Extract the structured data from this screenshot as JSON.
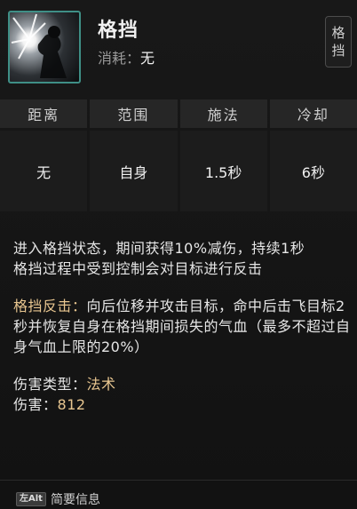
{
  "skill": {
    "name": "格挡",
    "cost_label": "消耗：",
    "cost_value": "无",
    "side_button": [
      "格",
      "挡"
    ]
  },
  "stats": {
    "headers": [
      "距离",
      "范围",
      "施法",
      "冷却"
    ],
    "values": [
      "无",
      "自身",
      "1.5秒",
      "6秒"
    ]
  },
  "description": {
    "line1": "进入格挡状态，期间获得10%减伤，持续1秒",
    "line2": "格挡过程中受到控制会对目标进行反击",
    "counter_label": "格挡反击：",
    "counter_text": "向后位移并攻击目标，命中后击飞目标2秒并恢复自身在格挡期间损失的气血（最多不超过自身气血上限的20%）",
    "damage_type_label": "伤害类型：",
    "damage_type_value": "法术",
    "damage_label": "伤害：",
    "damage_value": "812"
  },
  "footer": {
    "key_label": "左Alt",
    "text": "简要信息"
  },
  "colors": {
    "accent_gold": "#e8c690",
    "icon_border": "#3f8f86"
  }
}
